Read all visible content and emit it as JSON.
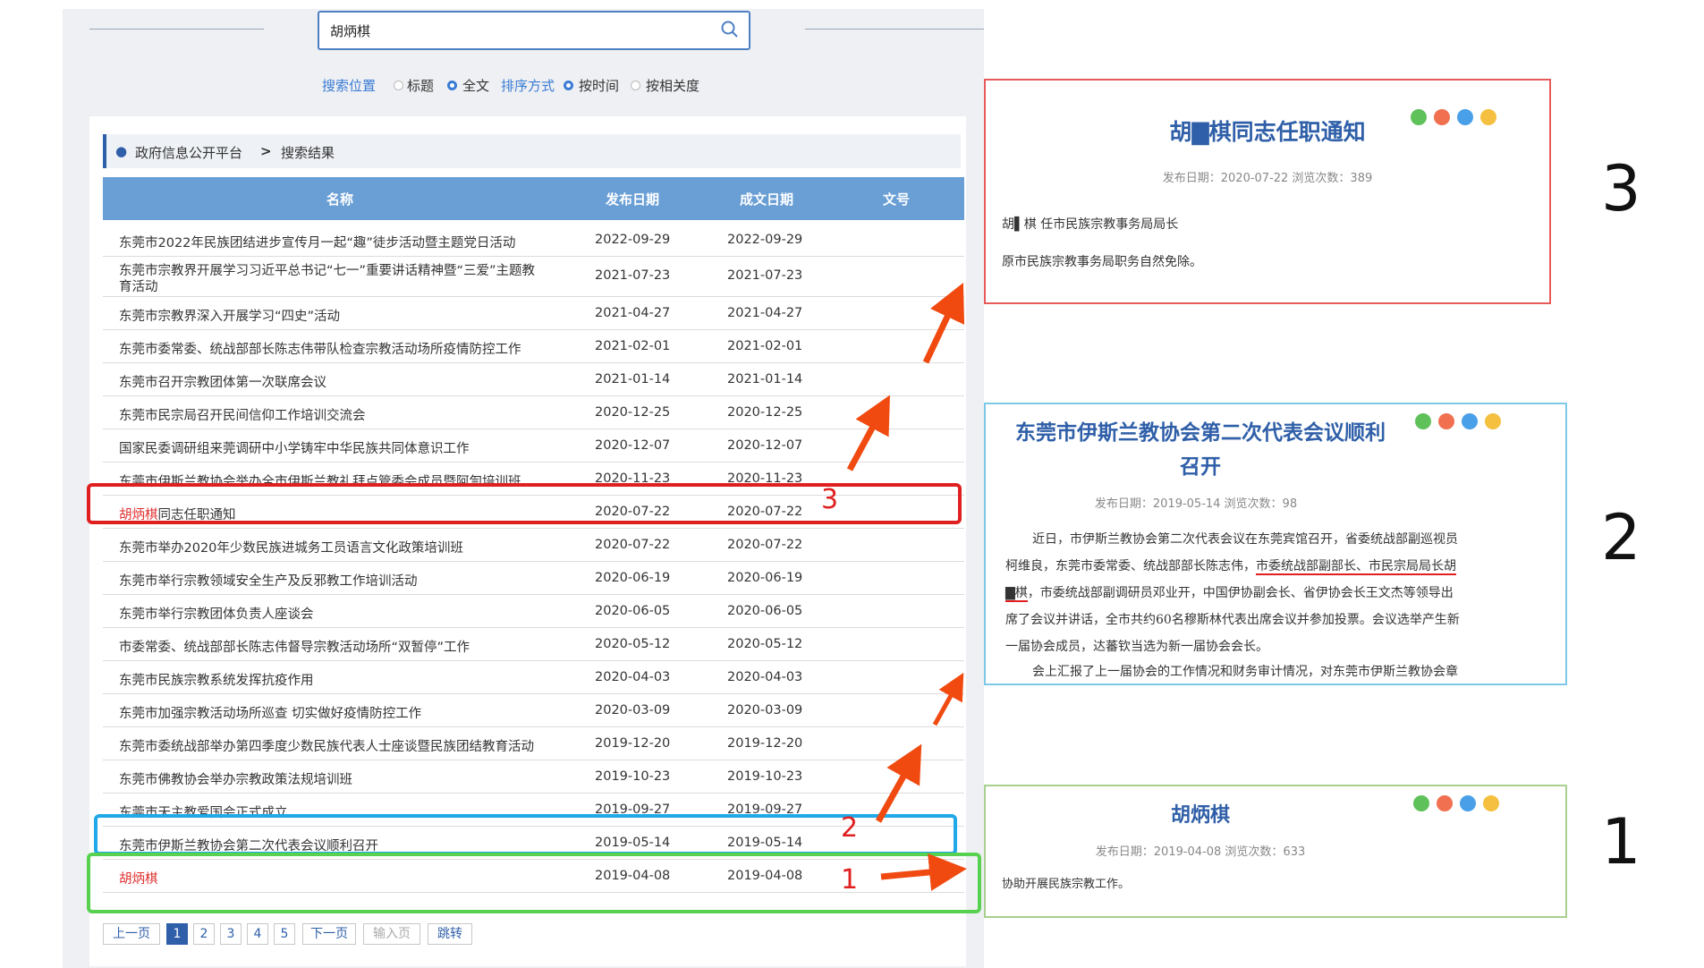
{
  "search": {
    "value": "胡炳棋"
  },
  "options": {
    "position_label": "搜索位置",
    "opt_title": "标题",
    "opt_full": "全文",
    "sort_label": "排序方式",
    "opt_time": "按时间",
    "opt_relevance": "按相关度"
  },
  "breadcrumb": {
    "home": "政府信息公开平台",
    "sep": ">",
    "current": "搜索结果"
  },
  "table": {
    "headers": {
      "name": "名称",
      "publish": "发布日期",
      "created": "成文日期",
      "docno": "文号"
    },
    "rows": [
      {
        "name": "东莞市2022年民族团结进步宣传月一起“趣”徒步活动暨主题党日活动",
        "d1": "2022-09-29",
        "d2": "2022-09-29"
      },
      {
        "name": "东莞市宗教界开展学习习近平总书记“七一”重要讲话精神暨“三爱”主题教",
        "name2": "育活动",
        "d1": "2021-07-23",
        "d2": "2021-07-23"
      },
      {
        "name": "东莞市宗教界深入开展学习“四史”活动",
        "d1": "2021-04-27",
        "d2": "2021-04-27"
      },
      {
        "name": "东莞市委常委、统战部部长陈志伟带队检查宗教活动场所疫情防控工作",
        "d1": "2021-02-01",
        "d2": "2021-02-01"
      },
      {
        "name": "东莞市召开宗教团体第一次联席会议",
        "d1": "2021-01-14",
        "d2": "2021-01-14"
      },
      {
        "name": "东莞市民宗局召开民间信仰工作培训交流会",
        "d1": "2020-12-25",
        "d2": "2020-12-25"
      },
      {
        "name": "国家民委调研组来莞调研中小学铸牢中华民族共同体意识工作",
        "d1": "2020-12-07",
        "d2": "2020-12-07"
      },
      {
        "name": "东莞市伊斯兰教协会举办全市伊斯兰教礼拜点管委会成员暨阿訇培训班",
        "d1": "2020-11-23",
        "d2": "2020-11-23"
      },
      {
        "name_hl": "胡炳棋",
        "name": "同志任职通知",
        "d1": "2020-07-22",
        "d2": "2020-07-22"
      },
      {
        "name": "东莞市举办2020年少数民族进城务工员语言文化政策培训班",
        "d1": "2020-07-22",
        "d2": "2020-07-22"
      },
      {
        "name": "东莞市举行宗教领域安全生产及反邪教工作培训活动",
        "d1": "2020-06-19",
        "d2": "2020-06-19"
      },
      {
        "name": "东莞市举行宗教团体负责人座谈会",
        "d1": "2020-06-05",
        "d2": "2020-06-05"
      },
      {
        "name": "市委常委、统战部部长陈志伟督导宗教活动场所“双暂停”工作",
        "d1": "2020-05-12",
        "d2": "2020-05-12"
      },
      {
        "name": "东莞市民族宗教系统发挥抗疫作用",
        "d1": "2020-04-03",
        "d2": "2020-04-03"
      },
      {
        "name": "东莞市加强宗教活动场所巡查 切实做好疫情防控工作",
        "d1": "2020-03-09",
        "d2": "2020-03-09"
      },
      {
        "name": "东莞市委统战部举办第四季度少数民族代表人士座谈暨民族团结教育活动",
        "d1": "2019-12-20",
        "d2": "2019-12-20"
      },
      {
        "name": "东莞市佛教协会举办宗教政策法规培训班",
        "d1": "2019-10-23",
        "d2": "2019-10-23"
      },
      {
        "name": "东莞市天主教爱国会正式成立",
        "d1": "2019-09-27",
        "d2": "2019-09-27"
      },
      {
        "name": "东莞市伊斯兰教协会第二次代表会议顺利召开",
        "d1": "2019-05-14",
        "d2": "2019-05-14"
      },
      {
        "name_hl": "胡炳棋",
        "name": "",
        "d1": "2019-04-08",
        "d2": "2019-04-08"
      }
    ]
  },
  "pager": {
    "prev": "上一页",
    "p1": "1",
    "p2": "2",
    "p3": "3",
    "p4": "4",
    "p5": "5",
    "next": "下一页",
    "input_placeholder": "输入页",
    "go": "跳转"
  },
  "annotations": {
    "n1": "1",
    "n2": "2",
    "n3": "3",
    "accent_red": "#e02020",
    "accent_blue": "#20a8e8",
    "accent_green": "#58d050"
  },
  "panel3": {
    "title": "胡▇棋同志任职通知",
    "meta": "发布日期：2020-07-22  浏览次数：389",
    "line1": "胡▌棋  任市民族宗教事务局局长",
    "line2": "原市民族宗教事务局职务自然免除。",
    "label": "3"
  },
  "panel2": {
    "title_l1": "东莞市伊斯兰教协会第二次代表会议顺利",
    "title_l2": "召开",
    "meta": "发布日期：2019-05-14  浏览次数：98",
    "p1": "近日，市伊斯兰教协会第二次代表会议在东莞宾馆召开，省委统战部副巡视员",
    "p2a": "柯维良，东莞市委常委、统战部部长陈志伟，",
    "p2b": "市委统战部副部长、市民宗局局长胡",
    "p3a": "▇棋",
    "p3b": "，市委统战部副调研员邓业开，中国伊协副会长、省伊协会长王文杰等领导出",
    "p4": "席了会议并讲话，全市共约60名穆斯林代表出席会议并参加投票。会议选举产生新",
    "p5": "一届协会成员，达蕃钦当选为新一届协会会长。",
    "p6": "会上汇报了上一届协会的工作情况和财务审计情况，对东莞市伊斯兰教协会章",
    "label": "2"
  },
  "panel1": {
    "title": "胡炳棋",
    "meta": "发布日期：2019-04-08  浏览次数：633",
    "line1": "协助开展民族宗教工作。",
    "label": "1"
  }
}
